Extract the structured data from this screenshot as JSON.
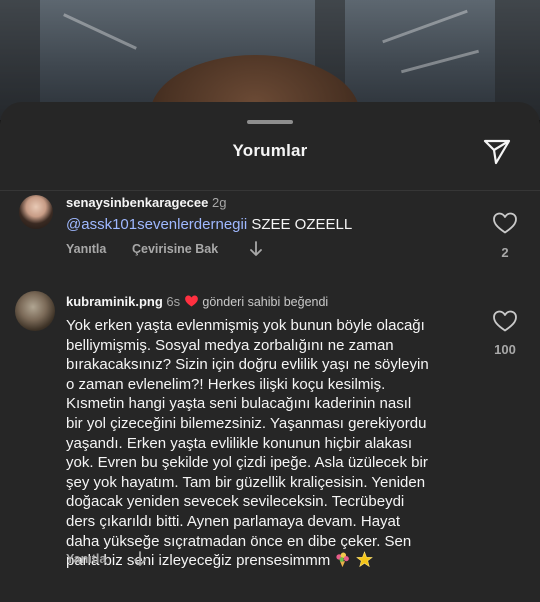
{
  "sheet": {
    "title": "Yorumlar"
  },
  "comments": [
    {
      "username": "senaysinbenkaragecee",
      "time": "2g",
      "mention": "@assk101sevenlerdernegii",
      "text": " SZEE OZEELL",
      "reply_label": "Yanıtla",
      "translate_label": "Çevirisine Bak",
      "likes": "2"
    },
    {
      "username": "kubraminik.png",
      "time": "6s",
      "liked_label": "gönderi sahibi beğendi",
      "text_lines": [
        "Yok erken yaşta evlenmişmiş yok bunun böyle olacağı",
        "belliymişmiş. Sosyal medya zorbalığını ne zaman",
        "bırakacaksınız? Sizin için doğru evlilik yaşı ne söyleyin",
        "o zaman evlenelim?! Herkes ilişki koçu kesilmiş.",
        "Kısmetin hangi yaşta seni bulacağını kaderinin nasıl",
        "bir yol çizeceğini bilemezsiniz. Yaşanması gerekiyordu",
        "yaşandı. Erken yaşta evlilikle konunun hiçbir alakası",
        "yok. Evren bu şekilde yol çizdi ipeğe. Asla üzülecek bir",
        "şey yok hayatım. Tam bir güzellik kraliçesisin. Yeniden",
        "doğacak yeniden sevecek sevileceksin. Tecrübeydi",
        "ders çıkarıldı bitti. Aynen parlamaya devam. Hayat",
        "daha yükseğe sıçratmadan önce en dibe çeker. Sen",
        "parla biz seni izleyeceğiz prensesimmm"
      ],
      "reply_label": "Yanıtla",
      "likes": "100"
    }
  ],
  "colors": {
    "sheet_bg": "#262626",
    "text": "#f5f5f5",
    "muted": "#a8a8a8",
    "mention": "#9fb8ff",
    "heart_red": "#ff3040"
  },
  "icons": [
    "send-icon",
    "heart-icon",
    "arrow-down-icon",
    "bouquet-emoji",
    "sparkle-star-emoji"
  ]
}
